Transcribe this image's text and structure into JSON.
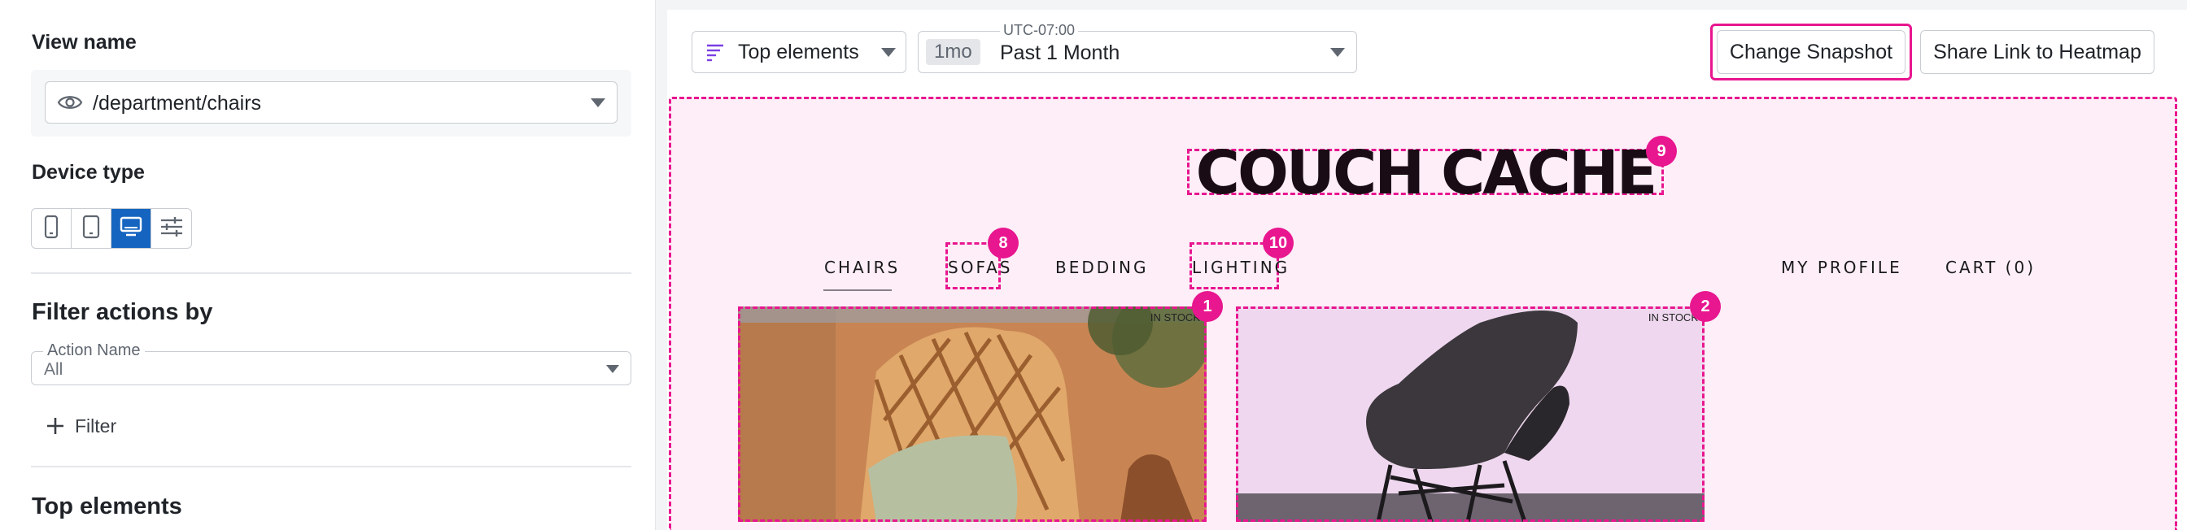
{
  "view": {
    "label": "View name",
    "value": "/department/chairs"
  },
  "device": {
    "label": "Device type",
    "icons": [
      "mobile-icon",
      "tablet-icon",
      "desktop-icon",
      "sliders-icon"
    ],
    "active": "desktop"
  },
  "filters": {
    "title": "Filter actions by",
    "action_name_label": "Action Name",
    "action_name_value": "All",
    "add_filter_label": "Filter"
  },
  "top_elements_title": "Top elements",
  "toolbar": {
    "top_elements_label": "Top elements",
    "timezone": "UTC-07:00",
    "range_badge": "1mo",
    "range_label": "Past 1 Month",
    "change_snapshot": "Change Snapshot",
    "share_link": "Share Link to Heatmap"
  },
  "site": {
    "logo": "COUCH CACHE",
    "nav": [
      "CHAIRS",
      "SOFAS",
      "BEDDING",
      "LIGHTING"
    ],
    "nav_right": [
      "MY PROFILE",
      "CART (0)"
    ],
    "product_tag": "IN STOCK"
  },
  "badges": {
    "logo": "9",
    "sofas": "8",
    "lighting": "10",
    "product1": "1",
    "product2": "2"
  },
  "colors": {
    "highlight": "#e8168f",
    "active_device": "#1565c0",
    "preview_bg": "#fdeef8"
  }
}
